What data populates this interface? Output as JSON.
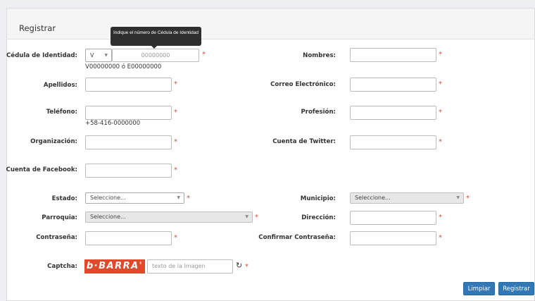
{
  "panel": {
    "title": "Registrar"
  },
  "tooltip": {
    "text": "Indique el número de Cédula de Identidad"
  },
  "fields": {
    "cedula": {
      "label": "Cédula de Identidad:",
      "prefix": "V",
      "placeholder": "00000000",
      "helper": "V00000000 ó E00000000"
    },
    "nombres": {
      "label": "Nombres:"
    },
    "apellidos": {
      "label": "Apellidos:"
    },
    "correo": {
      "label": "Correo Electrónico:"
    },
    "telefono": {
      "label": "Teléfono:",
      "helper": "+58-416-0000000"
    },
    "profesion": {
      "label": "Profesión:"
    },
    "organizacion": {
      "label": "Organización:"
    },
    "twitter": {
      "label": "Cuenta de Twitter:"
    },
    "facebook": {
      "label": "Cuenta de Facebook:"
    },
    "estado": {
      "label": "Estado:",
      "value": "Seleccione..."
    },
    "municipio": {
      "label": "Municipio:",
      "value": "Seleccione..."
    },
    "parroquia": {
      "label": "Parroquia:",
      "value": "Seleccione..."
    },
    "direccion": {
      "label": "Dirección:"
    },
    "contrasena": {
      "label": "Contraseña:"
    },
    "confirmar": {
      "label": "Confirmar Contraseña:"
    },
    "captcha": {
      "label": "Captcha:",
      "image_text": "b·BARRA'",
      "placeholder": "texto de la Imagen"
    }
  },
  "required_mark": "*",
  "buttons": {
    "limpiar": "Limpiar",
    "registrar": "Registrar"
  }
}
